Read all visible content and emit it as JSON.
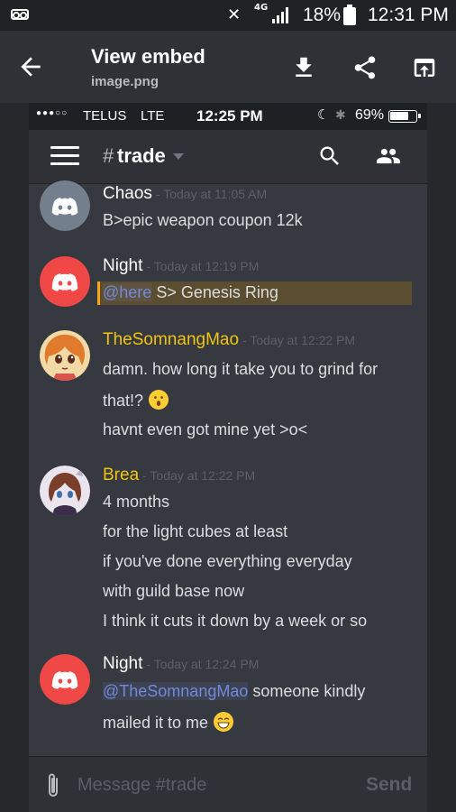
{
  "status_bar": {
    "network": "4G",
    "battery": "18%",
    "time": "12:31 PM"
  },
  "app_bar": {
    "title": "View embed",
    "subtitle": "image.png",
    "icons": [
      "back-arrow-icon",
      "download-icon",
      "share-icon",
      "open-external-icon"
    ]
  },
  "embed": {
    "ios_status": {
      "carrier": "TELUS",
      "network": "LTE",
      "time": "12:25 PM",
      "battery": "69%"
    },
    "channel": {
      "hash": "#",
      "name": "trade"
    },
    "messages": [
      {
        "author": "Chaos",
        "author_color": "#ffffff",
        "timestamp": "- Today at 11:05 AM",
        "avatar": "discord-grey",
        "lines": [
          "B>epic weapon coupon 12k"
        ]
      },
      {
        "author": "Night",
        "author_color": "#ffffff",
        "timestamp": "- Today at 12:19 PM",
        "avatar": "discord-red",
        "mention": "@here",
        "lines": [
          " S> Genesis Ring"
        ]
      },
      {
        "author": "TheSomnangMao",
        "author_color": "#f1c40f",
        "timestamp": "- Today at 12:22 PM",
        "avatar": "anime-girl",
        "lines": [
          "damn. how long it take you to grind for",
          "that!?",
          "havnt even got mine yet >o<"
        ]
      },
      {
        "author": "Brea",
        "author_color": "#f1c40f",
        "timestamp": "- Today at 12:22 PM",
        "avatar": "anime-character",
        "lines": [
          "4 months",
          "for the light cubes at least",
          "if you've done everything everyday",
          "with guild base now",
          "I think it cuts it down by a week or so"
        ]
      },
      {
        "author": "Night",
        "author_color": "#ffffff",
        "timestamp": "- Today at 12:24 PM",
        "avatar": "discord-red",
        "mention": "@TheSomnangMao",
        "lines": [
          " someone kindly",
          "mailed it to me"
        ]
      }
    ]
  },
  "composer": {
    "placeholder": "Message #trade",
    "send_label": "Send"
  },
  "colors": {
    "discord_red": "#f04747",
    "discord_grey": "#747f8d",
    "mention": "#7289da",
    "highlight_bar": "#faa61a"
  }
}
